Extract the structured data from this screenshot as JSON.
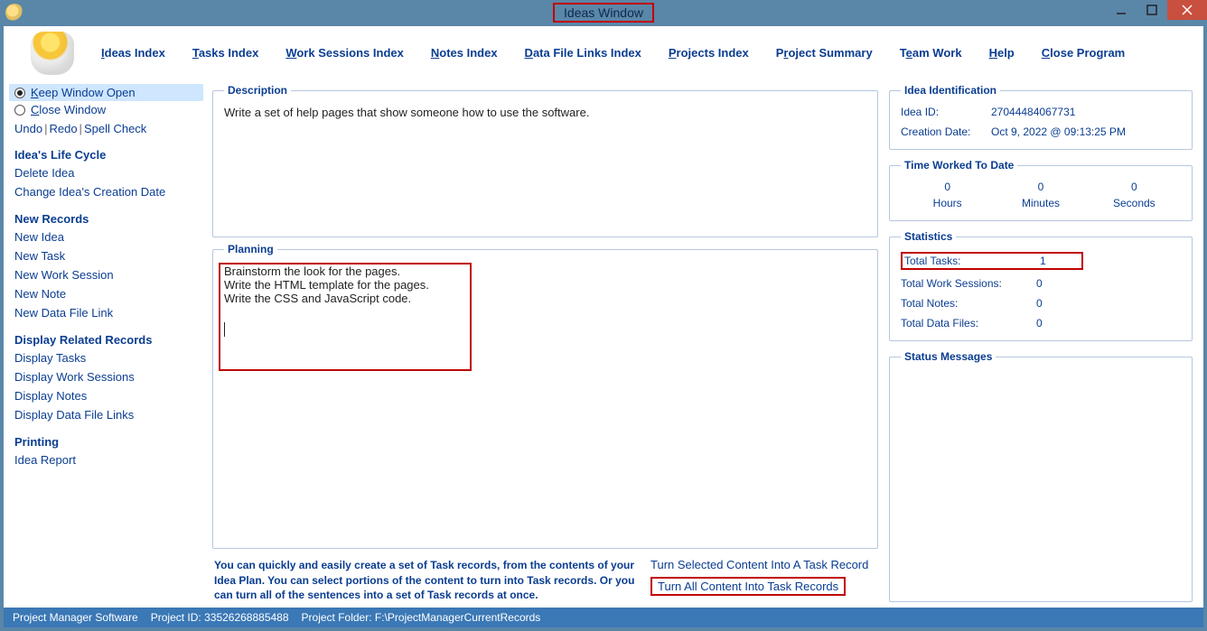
{
  "window": {
    "title": "Ideas Window"
  },
  "menu": {
    "ideas_index": "deas Index",
    "ideas_index_u": "I",
    "tasks_index": "asks Index",
    "tasks_index_u": "T",
    "work_sessions_index": "ork Sessions Index",
    "work_sessions_index_u": "W",
    "notes_index": "otes Index",
    "notes_index_u": "N",
    "data_links_index": "ata File Links Index",
    "data_links_index_u": "D",
    "projects_index": "rojects Index",
    "projects_index_u": "P",
    "project_summary_pre": "P",
    "project_summary_u": "r",
    "project_summary_post": "oject Summary",
    "team_work_pre": "T",
    "team_work_u": "e",
    "team_work_post": "am Work",
    "help_u": "H",
    "help_post": "elp",
    "close_program": "lose Program",
    "close_program_u": "C"
  },
  "left": {
    "radio_keep": "eep Window Open",
    "radio_keep_u": "K",
    "radio_close": "lose Window",
    "radio_close_u": "C",
    "undo": "Undo",
    "redo": "Redo",
    "spell": "Spell Check",
    "lifecycle_header": "Idea's Life Cycle",
    "delete_idea": "Delete Idea",
    "change_date": "Change Idea's Creation Date",
    "new_records_header": "New Records",
    "new_idea": "New Idea",
    "new_task": "New Task",
    "new_work_session": "New Work Session",
    "new_note": "New Note",
    "new_data_link": "New Data File Link",
    "display_header": "Display Related Records",
    "display_tasks": "Display Tasks",
    "display_work_sessions": "Display Work Sessions",
    "display_notes": "Display Notes",
    "display_data_links": "Display Data File Links",
    "printing_header": "Printing",
    "idea_report": "Idea Report"
  },
  "center": {
    "description_legend": "Description",
    "description_text": "Write a set of help pages that show someone how to use the software.",
    "planning_legend": "Planning",
    "planning_line1": "Brainstorm the look for the pages.",
    "planning_line2": "Write the HTML template for the pages.",
    "planning_line3": "Write the CSS and JavaScript code.",
    "footer_help": "You can quickly and easily create a set of Task records, from the contents of your Idea Plan. You can select portions of the content to turn into Task records. Or you can turn all of the sentences into a set of Task records at once.",
    "link_turn_selected": "Turn Selected Content Into A Task Record",
    "link_turn_all": "Turn All Content Into Task Records"
  },
  "right": {
    "ident_legend": "Idea Identification",
    "idea_id_label": "Idea ID:",
    "idea_id_value": "27044484067731",
    "creation_label": "Creation Date:",
    "creation_value": "Oct  9, 2022 @ 09:13:25 PM",
    "time_legend": "Time Worked To Date",
    "hours_val": "0",
    "min_val": "0",
    "sec_val": "0",
    "hours_label": "Hours",
    "min_label": "Minutes",
    "sec_label": "Seconds",
    "stats_legend": "Statistics",
    "total_tasks_label": "Total Tasks:",
    "total_tasks_val": "1",
    "total_ws_label": "Total Work Sessions:",
    "total_ws_val": "0",
    "total_notes_label": "Total Notes:",
    "total_notes_val": "0",
    "total_files_label": "Total Data Files:",
    "total_files_val": "0",
    "status_legend": "Status Messages"
  },
  "statusbar": {
    "app": "Project Manager Software",
    "project_id_label": "Project ID:",
    "project_id_value": "33526268885488",
    "project_folder_label": "Project Folder:",
    "project_folder_value": "F:\\ProjectManagerCurrentRecords"
  }
}
